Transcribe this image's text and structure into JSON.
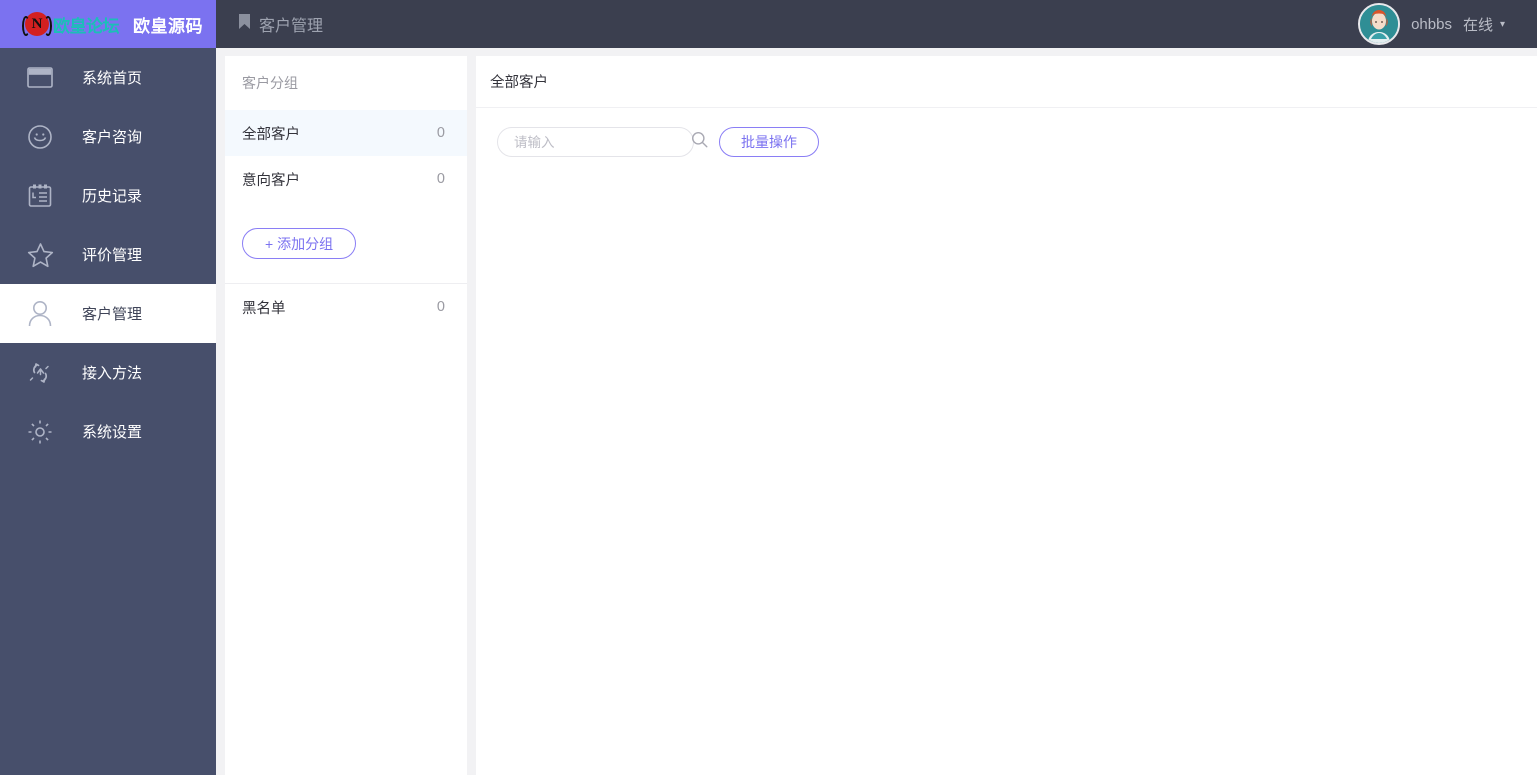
{
  "topbar": {
    "logo": {
      "badge_letter": "N",
      "forum_text": "欧皇论坛",
      "brand_text": "欧皇源码"
    },
    "page_title": "客户管理",
    "bookmark_icon": "bookmark-icon",
    "user": {
      "name": "ohbbs",
      "status": "在线",
      "caret": "▾",
      "avatar_icon": "user-avatar"
    }
  },
  "sidebar": {
    "items": [
      {
        "label": "系统首页",
        "icon": "window-icon",
        "active": false
      },
      {
        "label": "客户咨询",
        "icon": "smiley-icon",
        "active": false
      },
      {
        "label": "历史记录",
        "icon": "notepad-icon",
        "active": false
      },
      {
        "label": "评价管理",
        "icon": "star-icon",
        "active": false
      },
      {
        "label": "客户管理",
        "icon": "person-icon",
        "active": true
      },
      {
        "label": "接入方法",
        "icon": "connect-icon",
        "active": false
      },
      {
        "label": "系统设置",
        "icon": "gear-icon",
        "active": false
      }
    ]
  },
  "group_panel": {
    "title": "客户分组",
    "groups": [
      {
        "name": "全部客户",
        "count": "0",
        "selected": true
      },
      {
        "name": "意向客户",
        "count": "0",
        "selected": false
      }
    ],
    "add_button": "+ 添加分组",
    "blacklist": {
      "name": "黑名单",
      "count": "0"
    }
  },
  "content": {
    "title": "全部客户",
    "search": {
      "placeholder": "请输入",
      "value": "",
      "icon": "search-icon"
    },
    "batch_button": "批量操作"
  },
  "colors": {
    "logo_purple": "#7b72f0",
    "header_dark": "#3b3f4f",
    "sidebar_navy": "#474f6b",
    "accent_purple": "#7b72f0",
    "selected_row": "#f4f9fe",
    "page_bg": "#f2f2f4"
  }
}
